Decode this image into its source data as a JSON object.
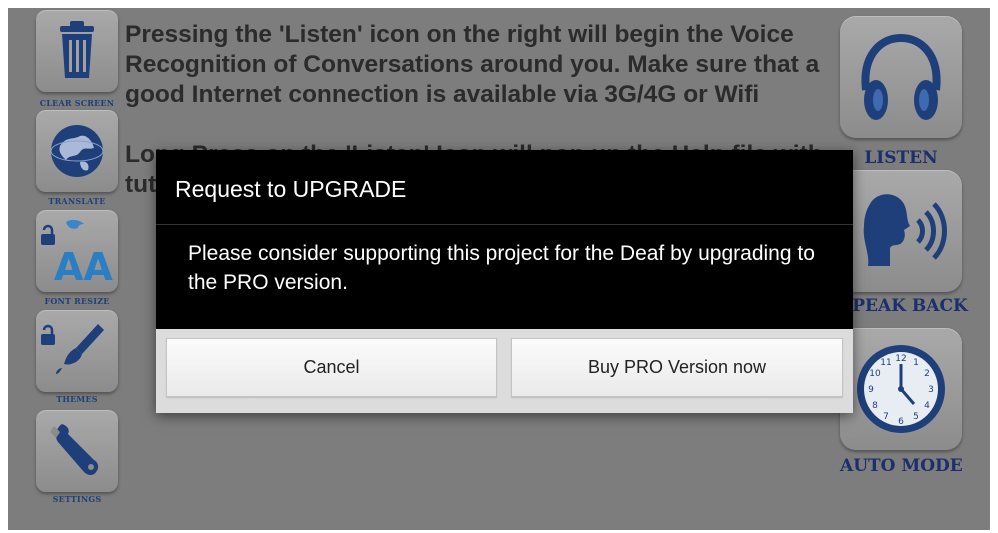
{
  "left_tools": [
    {
      "label": "CLEAR SCREEN",
      "icon": "trash-icon"
    },
    {
      "label": "TRANSLATE",
      "icon": "globe-icon"
    },
    {
      "label": "FONT RESIZE",
      "icon": "font-resize-icon"
    },
    {
      "label": "THEMES",
      "icon": "paintbrush-icon"
    },
    {
      "label": "SETTINGS",
      "icon": "wrench-icon"
    }
  ],
  "right_tools": [
    {
      "label": "LISTEN",
      "icon": "headphones-icon"
    },
    {
      "label": "SPEAK BACK",
      "icon": "speaking-head-icon"
    },
    {
      "label": "AUTO MODE",
      "icon": "clock-icon"
    }
  ],
  "instructions": {
    "paragraph1": "Pressing the 'Listen' icon on the right will begin the Voice Recognition of Conversations around you. Make sure that a good Internet connection is available via 3G/4G or Wifi",
    "paragraph2": "Long Press on the 'Listen' Icon will pop up the Help file with tutorial Video"
  },
  "dialog": {
    "title": "Request to UPGRADE",
    "message": "Please consider supporting this project for the Deaf by upgrading to the PRO version.",
    "cancel_label": "Cancel",
    "buy_label": "Buy PRO Version now"
  },
  "colors": {
    "background": "#7d7d7d",
    "icon_blue": "#1f3f7a",
    "dialog_bg": "#000000",
    "button_bg": "#f5f5f5"
  }
}
